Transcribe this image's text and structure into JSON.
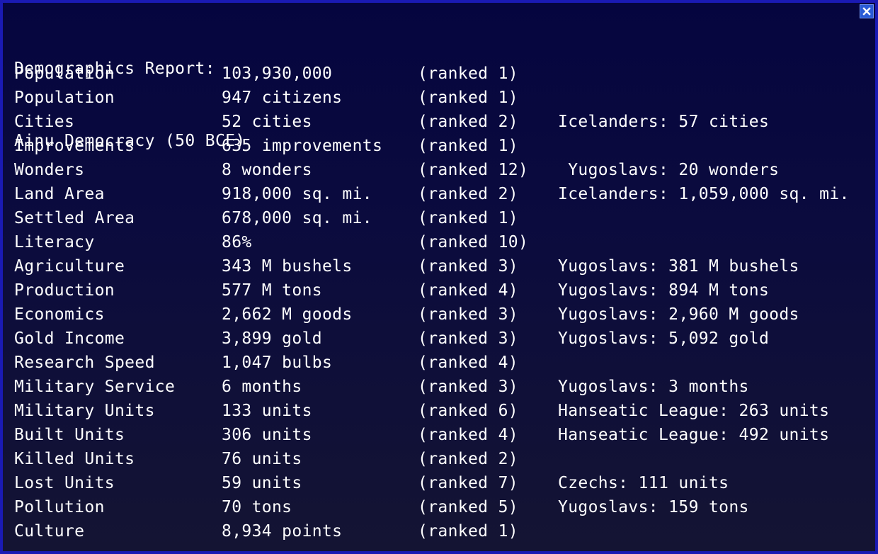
{
  "window": {
    "title_line1": "Demographics Report:",
    "title_line2": "Ainu Democracy (50 BCE)",
    "close_icon": "close-x-icon"
  },
  "colors": {
    "background": "#0b0b3e",
    "border": "#1a1ab4",
    "text": "#ffffff",
    "close_button": "#2a5bd6"
  },
  "rows": [
    {
      "label": "Population",
      "value": "103,930,000",
      "rank": "(ranked 1)",
      "best": ""
    },
    {
      "label": "Population",
      "value": "947 citizens",
      "rank": "(ranked 1)",
      "best": ""
    },
    {
      "label": "Cities",
      "value": "52 cities",
      "rank": "(ranked 2)",
      "best": "Icelanders: 57 cities"
    },
    {
      "label": "Improvements",
      "value": "635 improvements",
      "rank": "(ranked 1)",
      "best": ""
    },
    {
      "label": "Wonders",
      "value": "8 wonders",
      "rank": "(ranked 12)",
      "best": " Yugoslavs: 20 wonders"
    },
    {
      "label": "Land Area",
      "value": "918,000 sq. mi.",
      "rank": "(ranked 2)",
      "best": "Icelanders: 1,059,000 sq. mi."
    },
    {
      "label": "Settled Area",
      "value": "678,000 sq. mi.",
      "rank": "(ranked 1)",
      "best": ""
    },
    {
      "label": "Literacy",
      "value": "86%",
      "rank": "(ranked 10)",
      "best": ""
    },
    {
      "label": "Agriculture",
      "value": "343 M bushels",
      "rank": "(ranked 3)",
      "best": "Yugoslavs: 381 M bushels"
    },
    {
      "label": "Production",
      "value": "577 M tons",
      "rank": "(ranked 4)",
      "best": "Yugoslavs: 894 M tons"
    },
    {
      "label": "Economics",
      "value": "2,662 M goods",
      "rank": "(ranked 3)",
      "best": "Yugoslavs: 2,960 M goods"
    },
    {
      "label": "Gold Income",
      "value": "3,899 gold",
      "rank": "(ranked 3)",
      "best": "Yugoslavs: 5,092 gold"
    },
    {
      "label": "Research Speed",
      "value": "1,047 bulbs",
      "rank": "(ranked 4)",
      "best": ""
    },
    {
      "label": "Military Service",
      "value": "6 months",
      "rank": "(ranked 3)",
      "best": "Yugoslavs: 3 months"
    },
    {
      "label": "Military Units",
      "value": "133 units",
      "rank": "(ranked 6)",
      "best": "Hanseatic League: 263 units"
    },
    {
      "label": "Built Units",
      "value": "306 units",
      "rank": "(ranked 4)",
      "best": "Hanseatic League: 492 units"
    },
    {
      "label": "Killed Units",
      "value": "76 units",
      "rank": "(ranked 2)",
      "best": ""
    },
    {
      "label": "Lost Units",
      "value": "59 units",
      "rank": "(ranked 7)",
      "best": "Czechs: 111 units"
    },
    {
      "label": "Pollution",
      "value": "70 tons",
      "rank": "(ranked 5)",
      "best": "Yugoslavs: 159 tons"
    },
    {
      "label": "Culture",
      "value": "8,934 points",
      "rank": "(ranked 1)",
      "best": ""
    }
  ]
}
